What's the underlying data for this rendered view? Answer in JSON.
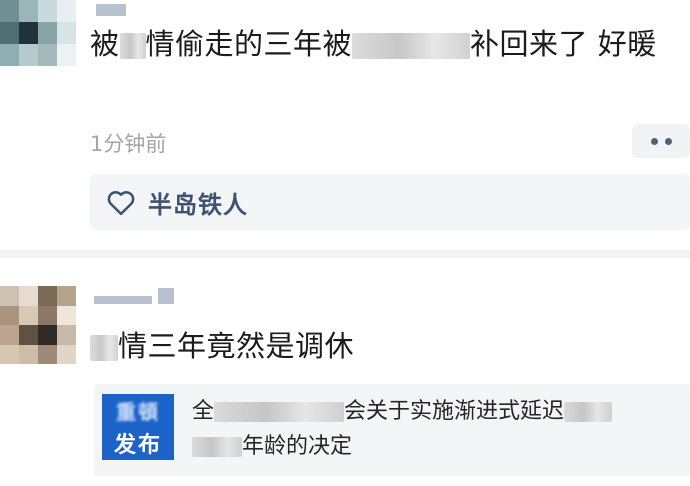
{
  "comments": [
    {
      "text_parts": [
        "被",
        "情偷走的三年被",
        "补回来了 好暖"
      ],
      "time": "1分钟前",
      "likes": {
        "user": "半岛铁人"
      }
    },
    {
      "text_parts": [
        "",
        "情三年竟然是调休"
      ],
      "link": {
        "thumb_line1": "重頓",
        "thumb_line2": "发布",
        "title_parts": [
          "全",
          "会关于实施渐进式延迟",
          "年龄的决定"
        ]
      }
    }
  ],
  "colors": {
    "liker": "#3d5272",
    "thumb_bg": "#1c63c8",
    "time": "#a5a5a5"
  },
  "icons": [
    "more-icon",
    "heart-icon"
  ]
}
